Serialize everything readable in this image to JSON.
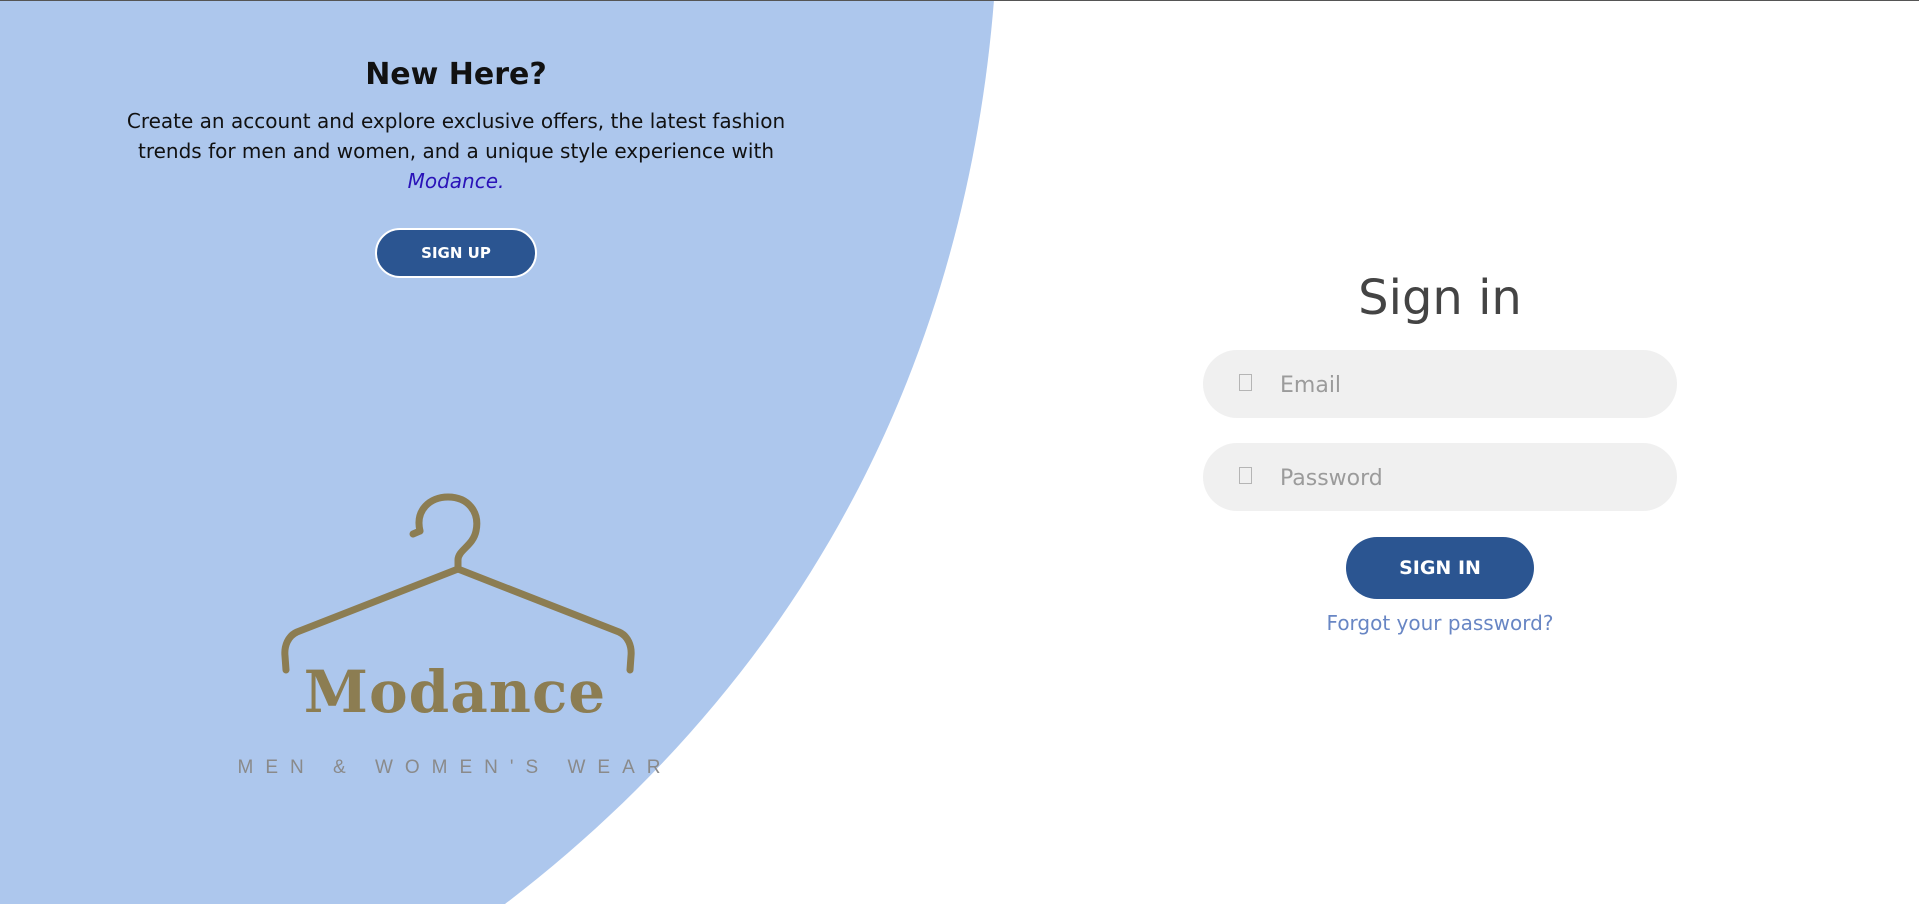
{
  "left_panel": {
    "title": "New Here?",
    "description": "Create an account and explore exclusive offers, the latest fashion trends for men and women, and a unique style experience with",
    "brand_link": "Modance.",
    "signup_label": "SIGN UP"
  },
  "logo": {
    "name": "Modance",
    "tagline": "MEN & WOMEN'S WEAR",
    "icon": "hanger-icon",
    "color": "#8c7d52"
  },
  "signin": {
    "title": "Sign in",
    "email_placeholder": "Email",
    "email_icon": "user-icon",
    "password_placeholder": "Password",
    "password_icon": "lock-icon",
    "submit_label": "SIGN IN",
    "forgot_label": "Forgot your password?"
  },
  "colors": {
    "panel_bg": "#adc7ed",
    "button_bg": "#2b5591",
    "brand_link": "#2a13b8",
    "forgot_link": "#6886c4",
    "input_bg": "#f0f0f0"
  }
}
